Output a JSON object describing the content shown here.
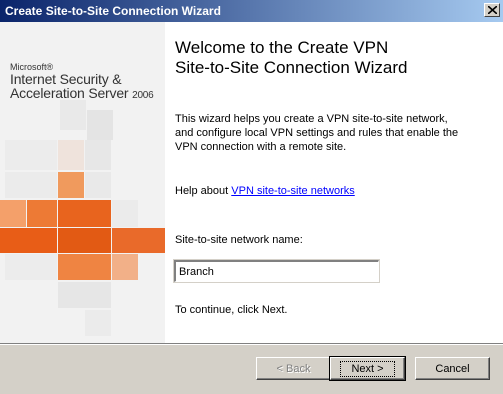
{
  "window": {
    "title": "Create Site-to-Site Connection Wizard"
  },
  "branding": {
    "company": "Microsoft®",
    "product_line1": "Internet Security &",
    "product_line2": "Acceleration Server",
    "product_year": "2006"
  },
  "content": {
    "heading": "Welcome to the Create VPN\nSite-to-Site Connection Wizard",
    "description": "This wizard helps you create a VPN site-to-site network,\nand configure local VPN settings and rules that enable the\nVPN connection with a remote site.",
    "help_prefix": "Help about ",
    "help_link": "VPN site-to-site networks",
    "name_label": "Site-to-site network name:",
    "name_value": "Branch",
    "continue_text": "To continue, click Next."
  },
  "buttons": {
    "back": "< Back",
    "next": "Next >",
    "cancel": "Cancel"
  },
  "colors": {
    "title_gradient_start": "#0a246a",
    "title_gradient_end": "#a6caf0",
    "accent_orange": "#e8641e",
    "link": "#0000ff"
  }
}
